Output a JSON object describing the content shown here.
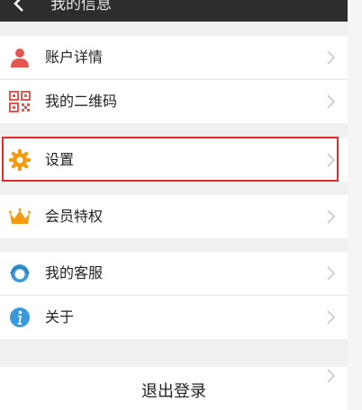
{
  "header": {
    "title": "我的信息",
    "back_icon": "chevron-left-icon"
  },
  "groups": [
    {
      "items": [
        {
          "label": "账户详情",
          "icon": "person-icon"
        },
        {
          "label": "我的二维码",
          "icon": "qr-code-icon"
        }
      ]
    },
    {
      "items": [
        {
          "label": "设置",
          "icon": "gear-icon"
        }
      ]
    },
    {
      "items": [
        {
          "label": "会员特权",
          "icon": "crown-icon"
        }
      ]
    },
    {
      "items": [
        {
          "label": "我的客服",
          "icon": "customer-service-icon"
        },
        {
          "label": "关于",
          "icon": "info-icon"
        }
      ]
    }
  ],
  "logout": {
    "label": "退出登录"
  },
  "colors": {
    "header_bg": "#2d2d2d",
    "highlight_border": "#e32b2b",
    "person_icon": "#e8554e",
    "qr_icon": "#e8554e",
    "gear_icon": "#f39c12",
    "crown_icon": "#f39c12",
    "service_icon": "#3a9ad9",
    "info_icon": "#3a9ad9"
  }
}
